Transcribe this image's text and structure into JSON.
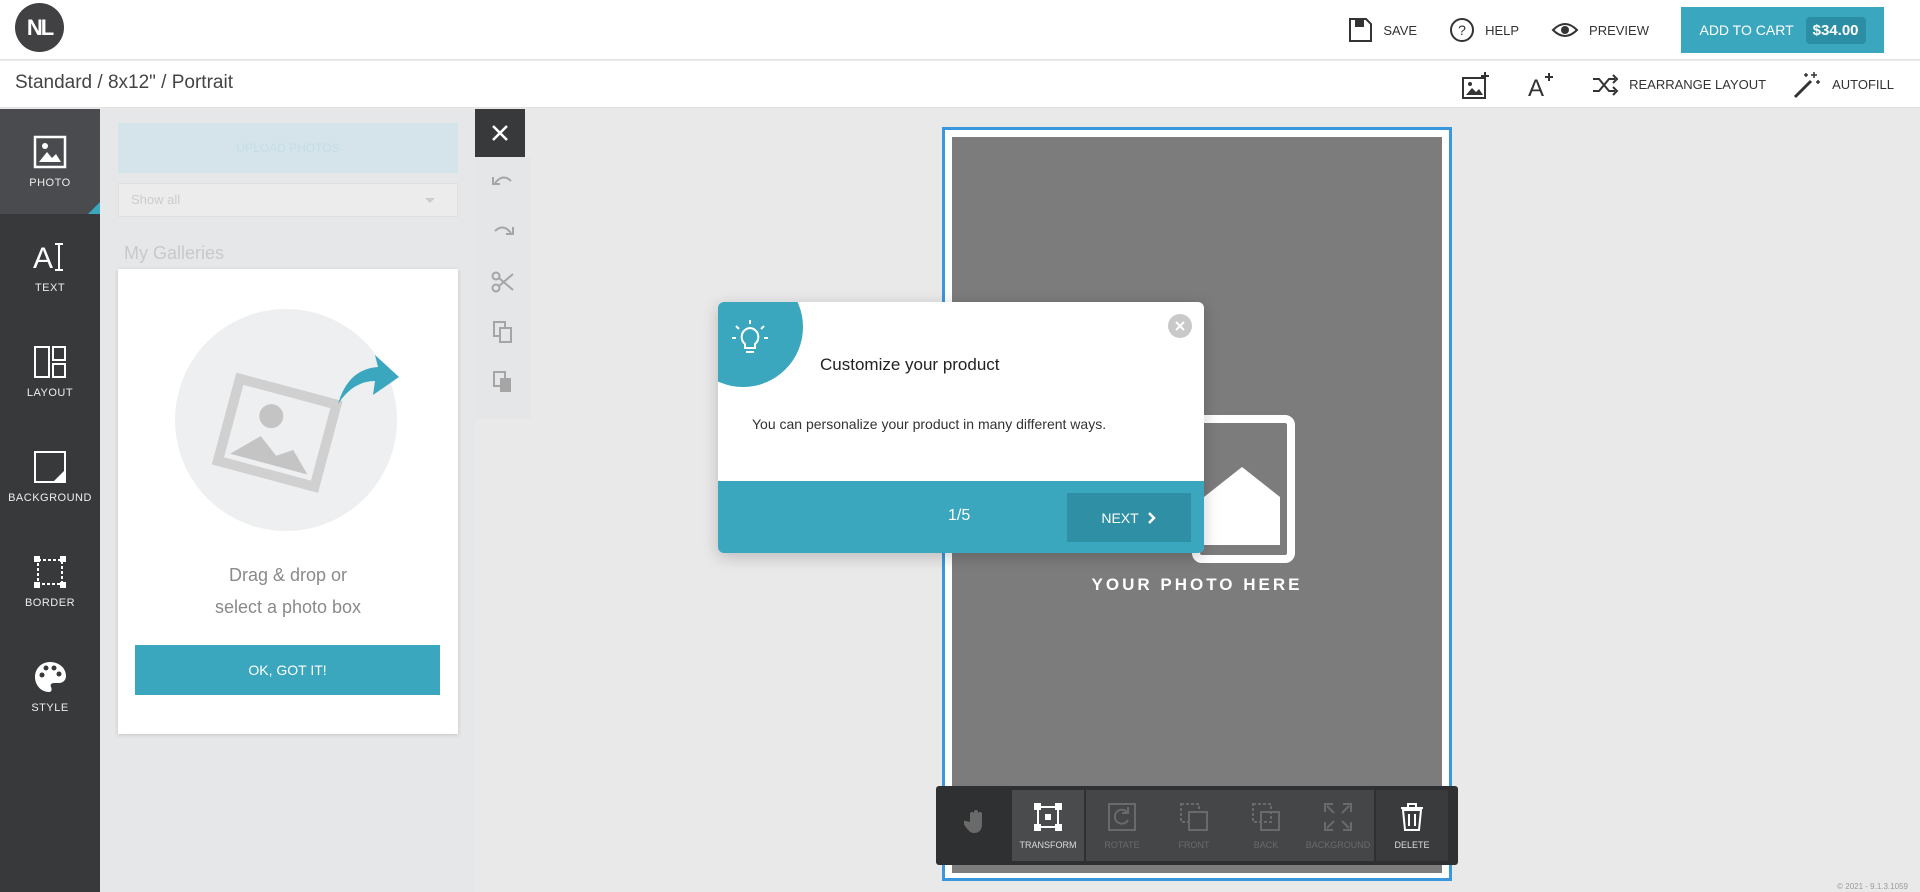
{
  "header": {
    "logo_text": "NL",
    "save_label": "SAVE",
    "help_label": "HELP",
    "preview_label": "PREVIEW",
    "cart_label": "ADD TO CART",
    "cart_price": "$34.00"
  },
  "subbar": {
    "breadcrumb": "Standard / 8x12\" / Portrait",
    "rearrange_label": "REARRANGE LAYOUT",
    "autofill_label": "AUTOFILL"
  },
  "sidebar": {
    "items": [
      {
        "label": "PHOTO",
        "icon": "photo-icon"
      },
      {
        "label": "TEXT",
        "icon": "text-icon"
      },
      {
        "label": "LAYOUT",
        "icon": "layout-icon"
      },
      {
        "label": "BACKGROUND",
        "icon": "background-icon"
      },
      {
        "label": "BORDER",
        "icon": "border-icon"
      },
      {
        "label": "STYLE",
        "icon": "palette-icon"
      }
    ]
  },
  "panel": {
    "upload_label": "UPLOAD PHOTOS",
    "filter_value": "Show all",
    "galleries_title": "My Galleries",
    "drag_line1": "Drag & drop or",
    "drag_line2": "select a photo box",
    "ok_label": "OK, GOT IT!"
  },
  "canvas": {
    "photo_here": "YOUR PHOTO HERE"
  },
  "bottom_toolbar": {
    "transform": "TRANSFORM",
    "rotate": "ROTATE",
    "front": "FRONT",
    "back": "BACK",
    "background": "BACKGROUND",
    "delete": "DELETE"
  },
  "dialog": {
    "title": "Customize your product",
    "body": "You can personalize your product in many different ways.",
    "step": "1/5",
    "next_label": "NEXT"
  },
  "footer": {
    "version": "© 2021 - 9.1.3.1059"
  },
  "colors": {
    "accent": "#3ba7bf",
    "sidebar": "#38393b",
    "frame": "#3a97dc"
  }
}
